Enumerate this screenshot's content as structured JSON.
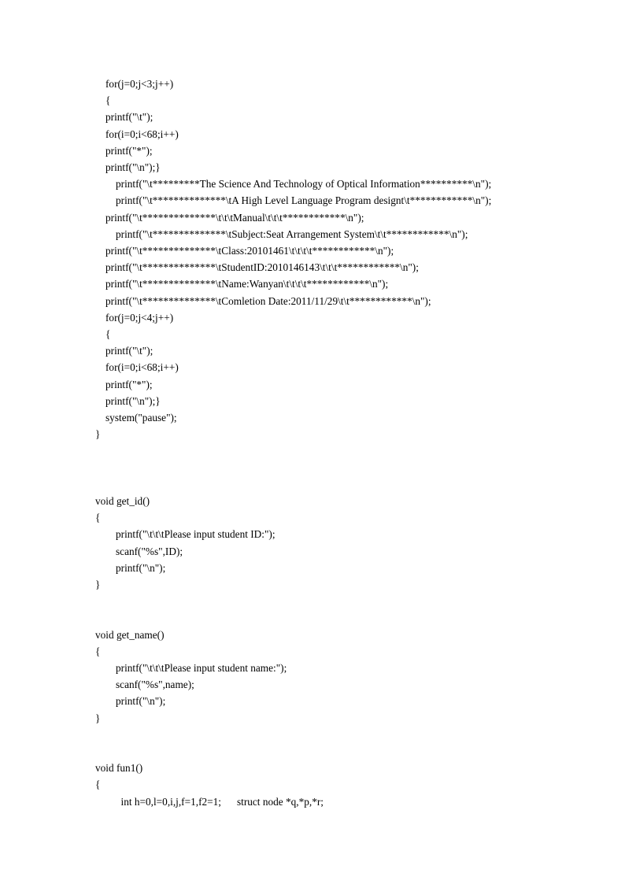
{
  "document": {
    "page_background": "#ffffff",
    "text_color": "#000000",
    "language": "C"
  },
  "code": {
    "blocks": [
      {
        "id": "menu-banner-block",
        "lines": [
          {
            "kind": "plain",
            "indent": 2,
            "text": "for(j=0;j<3;j++)"
          },
          {
            "kind": "plain",
            "indent": 2,
            "text": "{"
          },
          {
            "kind": "plain",
            "indent": 2,
            "text": "printf(\"\\t\");"
          },
          {
            "kind": "plain",
            "indent": 2,
            "text": "for(i=0;i<68;i++)"
          },
          {
            "kind": "plain",
            "indent": 2,
            "text": "printf(\"*\");"
          },
          {
            "kind": "plain",
            "indent": 2,
            "text": "printf(\"\\n\");}"
          },
          {
            "kind": "wrap",
            "text": "printf(\"\\t*********The Science And Technology of Optical Information**********\\n\");"
          },
          {
            "kind": "wrap",
            "text": "printf(\"\\t**************\\tA High Level Language Program designt\\t************\\n\");"
          },
          {
            "kind": "plain",
            "indent": 2,
            "text": "printf(\"\\t**************\\t\\t\\tManual\\t\\t\\t************\\n\");"
          },
          {
            "kind": "wrap",
            "text": "printf(\"\\t**************\\tSubject:Seat Arrangement System\\t\\t************\\n\");"
          },
          {
            "kind": "plain",
            "indent": 2,
            "text": "printf(\"\\t**************\\tClass:20101461\\t\\t\\t\\t************\\n\");"
          },
          {
            "kind": "plain",
            "indent": 2,
            "text": "printf(\"\\t**************\\tStudentID:2010146143\\t\\t\\t************\\n\");"
          },
          {
            "kind": "plain",
            "indent": 2,
            "text": "printf(\"\\t**************\\tName:Wanyan\\t\\t\\t\\t************\\n\");"
          },
          {
            "kind": "plain",
            "indent": 2,
            "text": "printf(\"\\t**************\\tComletion Date:2011/11/29\\t\\t************\\n\");"
          },
          {
            "kind": "plain",
            "indent": 2,
            "text": "for(j=0;j<4;j++)"
          },
          {
            "kind": "plain",
            "indent": 2,
            "text": "{"
          },
          {
            "kind": "plain",
            "indent": 2,
            "text": "printf(\"\\t\");"
          },
          {
            "kind": "plain",
            "indent": 2,
            "text": "for(i=0;i<68;i++)"
          },
          {
            "kind": "plain",
            "indent": 2,
            "text": "printf(\"*\");"
          },
          {
            "kind": "plain",
            "indent": 2,
            "text": "printf(\"\\n\");}"
          },
          {
            "kind": "plain",
            "indent": 2,
            "text": "system(\"pause\");"
          },
          {
            "kind": "plain",
            "indent": 0,
            "text": "}"
          }
        ]
      },
      {
        "id": "gap-after-menu-block",
        "lines": [
          {
            "kind": "blank",
            "indent": 0,
            "text": ""
          },
          {
            "kind": "blank",
            "indent": 0,
            "text": ""
          },
          {
            "kind": "blank",
            "indent": 0,
            "text": ""
          }
        ]
      },
      {
        "id": "get-id-function-block",
        "lines": [
          {
            "kind": "plain",
            "indent": 0,
            "text": "void get_id()"
          },
          {
            "kind": "plain",
            "indent": 0,
            "text": "{"
          },
          {
            "kind": "plain",
            "indent": 4,
            "text": "printf(\"\\t\\t\\tPlease input student ID:\");"
          },
          {
            "kind": "plain",
            "indent": 4,
            "text": "scanf(\"%s\",ID);"
          },
          {
            "kind": "plain",
            "indent": 4,
            "text": "printf(\"\\n\");"
          },
          {
            "kind": "plain",
            "indent": 0,
            "text": "}"
          }
        ]
      },
      {
        "id": "gap-after-get-id-block",
        "lines": [
          {
            "kind": "blank",
            "indent": 0,
            "text": ""
          },
          {
            "kind": "blank",
            "indent": 0,
            "text": ""
          }
        ]
      },
      {
        "id": "get-name-function-block",
        "lines": [
          {
            "kind": "plain",
            "indent": 0,
            "text": "void get_name()"
          },
          {
            "kind": "plain",
            "indent": 0,
            "text": "{"
          },
          {
            "kind": "plain",
            "indent": 4,
            "text": "printf(\"\\t\\t\\tPlease input student name:\");"
          },
          {
            "kind": "plain",
            "indent": 4,
            "text": "scanf(\"%s\",name);"
          },
          {
            "kind": "plain",
            "indent": 4,
            "text": "printf(\"\\n\");"
          },
          {
            "kind": "plain",
            "indent": 0,
            "text": "}"
          }
        ]
      },
      {
        "id": "gap-after-get-name-block",
        "lines": [
          {
            "kind": "blank",
            "indent": 0,
            "text": ""
          },
          {
            "kind": "blank",
            "indent": 0,
            "text": ""
          }
        ]
      },
      {
        "id": "fun1-function-block",
        "lines": [
          {
            "kind": "plain",
            "indent": 0,
            "text": "void fun1()"
          },
          {
            "kind": "plain",
            "indent": 0,
            "text": "{"
          },
          {
            "kind": "plain",
            "indent": 5,
            "text": "int h=0,l=0,i,j,f=1,f2=1;      struct node *q,*p,*r;"
          }
        ]
      }
    ]
  }
}
